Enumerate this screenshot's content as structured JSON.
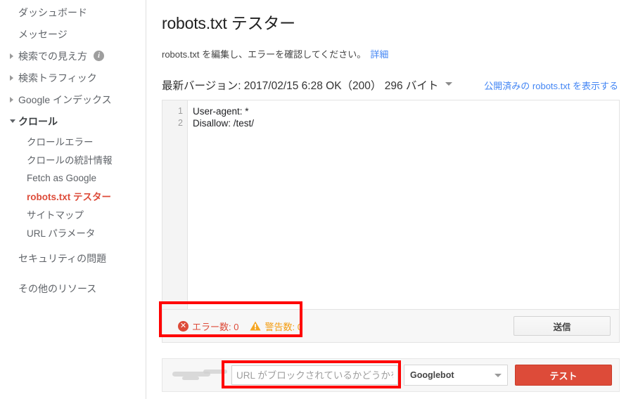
{
  "sidebar": {
    "items": [
      {
        "label": "ダッシュボード",
        "type": "plain",
        "icon": null
      },
      {
        "label": "メッセージ",
        "type": "plain",
        "icon": null
      },
      {
        "label": "検索での見え方",
        "type": "collapsed",
        "icon": "chevron-right-icon",
        "badge": "info-icon",
        "badge_glyph": "i"
      },
      {
        "label": "検索トラフィック",
        "type": "collapsed",
        "icon": "chevron-right-icon"
      },
      {
        "label": "Google インデックス",
        "type": "collapsed",
        "icon": "chevron-right-icon"
      },
      {
        "label": "クロール",
        "type": "expanded",
        "icon": "chevron-down-icon"
      }
    ],
    "crawl_children": [
      {
        "label": "クロールエラー",
        "active": false
      },
      {
        "label": "クロールの統計情報",
        "active": false
      },
      {
        "label": "Fetch as Google",
        "active": false
      },
      {
        "label": "robots.txt テスター",
        "active": true
      },
      {
        "label": "サイトマップ",
        "active": false
      },
      {
        "label": "URL パラメータ",
        "active": false
      }
    ],
    "footer_items": [
      {
        "label": "セキュリティの問題"
      },
      {
        "label": "その他のリソース"
      }
    ],
    "active_color": "#dd4b39"
  },
  "main": {
    "title": "robots.txt テスター",
    "subtitle": "robots.txt を編集し、エラーを確認してください。",
    "subtitle_link": "詳細",
    "version_label": "最新バージョン: 2017/02/15 6:28 OK（200）  296 バイト",
    "version_caret": "chevron-down-icon",
    "published_link": "公開済みの robots.txt を表示する",
    "link_color": "#4285f4"
  },
  "editor": {
    "lines": [
      {
        "number": "1",
        "text": "User-agent: *"
      },
      {
        "number": "2",
        "text": "Disallow: /test/"
      }
    ]
  },
  "status": {
    "error_icon": "error-circle-icon",
    "error_glyph": "✕",
    "error_label": "エラー数: 0",
    "error_color": "#dd4b39",
    "warning_icon": "warning-triangle-icon",
    "warning_label": "警告数: 0",
    "warning_color": "#f39c12",
    "submit_label": "送信"
  },
  "test_bar": {
    "domain_prefix": "",
    "url_placeholder": "URL がブロックされているかどうかをテ",
    "url_value": "",
    "bot_selected": "Googlebot",
    "bot_caret": "chevron-down-icon",
    "test_label": "テスト",
    "test_button_color": "#dd4b39"
  },
  "annotations": {
    "box_color": "#ff0000",
    "boxes": [
      {
        "name": "errors-warnings-highlight"
      },
      {
        "name": "url-input-highlight"
      }
    ]
  }
}
